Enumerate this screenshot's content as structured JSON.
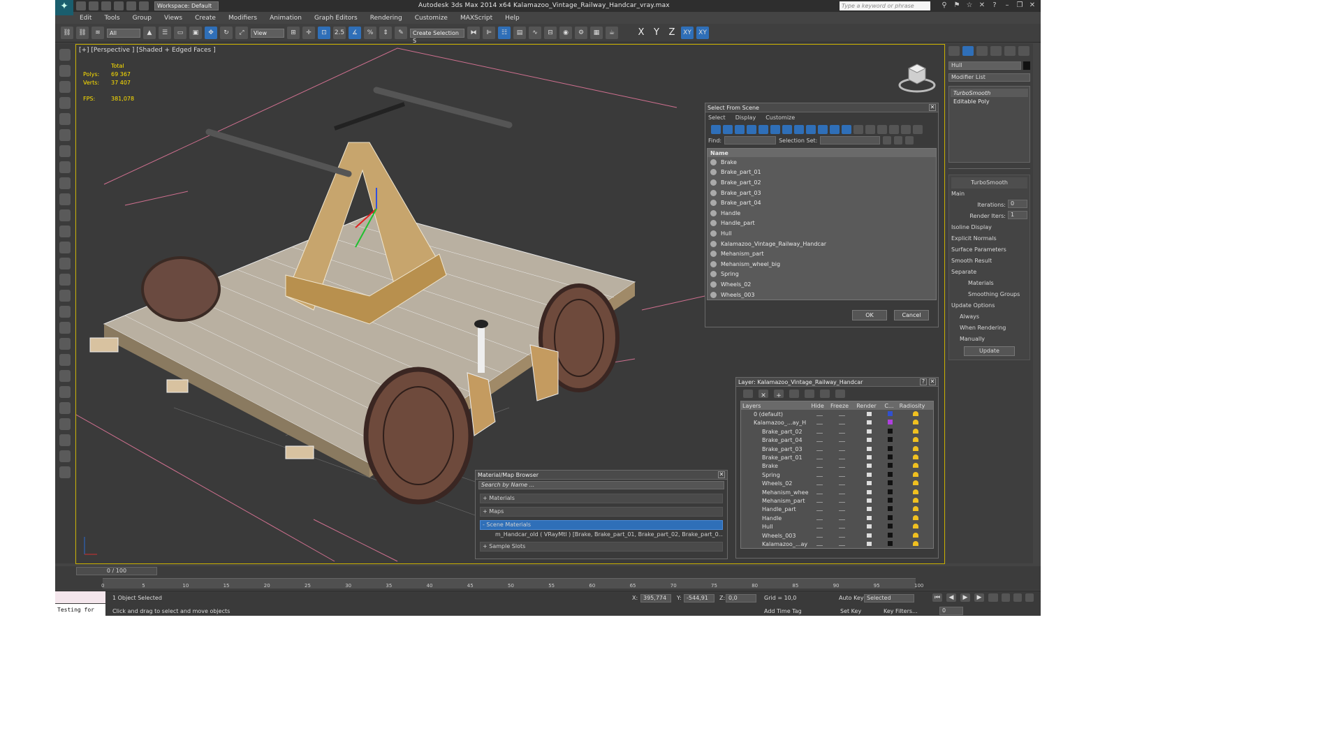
{
  "app": {
    "title": "Autodesk 3ds Max  2014 x64     Kalamazoo_Vintage_Railway_Handcar_vray.max",
    "workspace": "Workspace: Default",
    "keyword_placeholder": "Type a keyword or phrase"
  },
  "menu": [
    "Edit",
    "Tools",
    "Group",
    "Views",
    "Create",
    "Modifiers",
    "Animation",
    "Graph Editors",
    "Rendering",
    "Customize",
    "MAXScript",
    "Help"
  ],
  "toolbar": {
    "filter": "All",
    "view": "View",
    "create_selection": "Create Selection S",
    "axes": [
      "X",
      "Y",
      "Z",
      "XY",
      "XY"
    ]
  },
  "viewport": {
    "label": "[+] [Perspective ] [Shaded + Edged Faces ]",
    "stats": {
      "total_label": "Total",
      "polys_label": "Polys:",
      "polys": "69 367",
      "verts_label": "Verts:",
      "verts": "37 407",
      "fps_label": "FPS:",
      "fps": "381,078"
    }
  },
  "command_panel": {
    "object_name": "Hull",
    "modifier_list": "Modifier List",
    "stack": [
      "TurboSmooth",
      "Editable Poly"
    ],
    "rollout_title": "TurboSmooth",
    "main_label": "Main",
    "iterations_label": "Iterations:",
    "iterations": "0",
    "render_iters_label": "Render Iters:",
    "render_iters": "1",
    "isoline": "Isoline Display",
    "explicit": "Explicit Normals",
    "surface_label": "Surface Parameters",
    "smooth_result": "Smooth Result",
    "separate_label": "Separate",
    "materials": "Materials",
    "smoothing_groups": "Smoothing Groups",
    "update_options": "Update Options",
    "always": "Always",
    "when_rendering": "When Rendering",
    "manually": "Manually",
    "update_btn": "Update"
  },
  "select_scene": {
    "title": "Select From Scene",
    "menu": [
      "Select",
      "Display",
      "Customize"
    ],
    "find_label": "Find:",
    "selset_label": "Selection Set:",
    "col_name": "Name",
    "items": [
      "Brake",
      "Brake_part_01",
      "Brake_part_02",
      "Brake_part_03",
      "Brake_part_04",
      "Handle",
      "Handle_part",
      "Hull",
      "Kalamazoo_Vintage_Railway_Handcar",
      "Mehanism_part",
      "Mehanism_wheel_big",
      "Spring",
      "Wheels_02",
      "Wheels_003"
    ],
    "ok": "OK",
    "cancel": "Cancel"
  },
  "layer": {
    "title": "Layer: Kalamazoo_Vintage_Railway_Handcar",
    "cols": [
      "Layers",
      "Hide",
      "Freeze",
      "Render",
      "C...",
      "Radiosity"
    ],
    "rows": [
      "0 (default)",
      "Kalamazoo_...ay_H",
      "Brake_part_02",
      "Brake_part_04",
      "Brake_part_03",
      "Brake_part_01",
      "Brake",
      "Spring",
      "Wheels_02",
      "Mehanism_whee",
      "Mehanism_part",
      "Handle_part",
      "Handle",
      "Hull",
      "Wheels_003",
      "Kalamazoo_...ay"
    ]
  },
  "matbrowser": {
    "title": "Material/Map Browser",
    "search": "Search by Name ...",
    "sections": [
      "+ Materials",
      "+ Maps",
      "- Scene Materials",
      "+ Sample Slots"
    ],
    "material": "m_Handcar_old  ( VRayMtl ) [Brake, Brake_part_01, Brake_part_02, Brake_part_0..."
  },
  "timeline": {
    "frame": "0 / 100",
    "ticks": [
      "0",
      "5",
      "10",
      "15",
      "20",
      "25",
      "30",
      "35",
      "40",
      "45",
      "50",
      "55",
      "60",
      "65",
      "70",
      "75",
      "80",
      "85",
      "90",
      "95",
      "100"
    ]
  },
  "status": {
    "testing": "Testing for",
    "selected": "1 Object Selected",
    "prompt": "Click and drag to select and move objects",
    "x_label": "X:",
    "x": "395,774",
    "y_label": "Y:",
    "y": "-544,91",
    "z_label": "Z:",
    "z": "0,0",
    "grid": "Grid = 10,0",
    "add_time_tag": "Add Time Tag",
    "auto_key": "Auto Key",
    "selected_dd": "Selected",
    "set_key": "Set Key",
    "key_filters": "Key Filters...",
    "frame_field": "0"
  }
}
